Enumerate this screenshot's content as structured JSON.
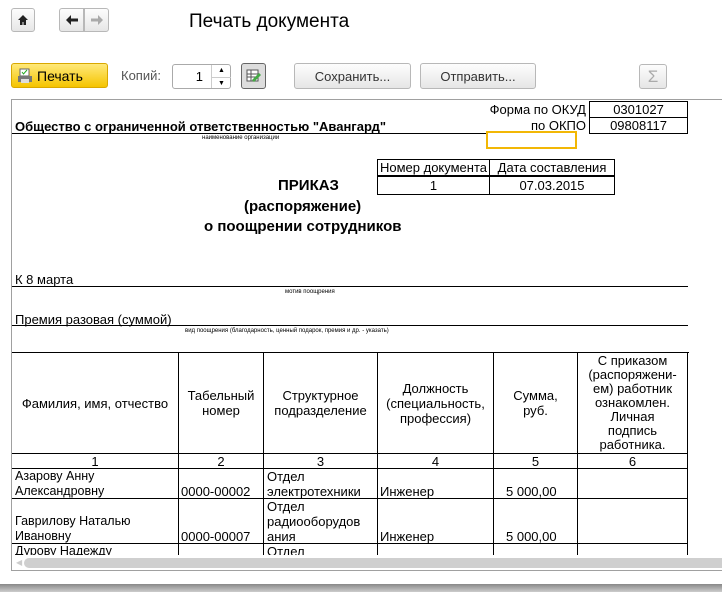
{
  "window": {
    "title": "Печать документа"
  },
  "toolbar": {
    "print_label": "Печать",
    "copies_label": "Копий:",
    "copies_value": "1",
    "save_label": "Сохранить...",
    "send_label": "Отправить...",
    "sum_symbol": "Σ"
  },
  "doc": {
    "org_name": "Общество с ограниченной ответственностью \"Авангард\"",
    "org_caption": "наименование организации",
    "okud_label": "Форма по ОКУД",
    "okud_value": "0301027",
    "okpo_label": "по ОКПО",
    "okpo_value": "09808117",
    "docnum_header": "Номер документа",
    "date_header": "Дата составления",
    "docnum_value": "1",
    "date_value": "07.03.2015",
    "title1": "ПРИКАЗ",
    "title2": "(распоряжение)",
    "title3": "о поощрении сотрудников",
    "motive": "К 8 марта",
    "motive_caption": "мотив поощрения",
    "kind": "Премия разовая (суммой)",
    "kind_caption": "вид поощрения (благодарность, ценный подарок, премия и др. - указать)",
    "columns": [
      "Фамилия, имя, отчество",
      "Табельный номер",
      "Структурное подразделение",
      "Должность (специальность, профессия)",
      "Сумма, руб.",
      "С приказом (распоряжени-ем) работник ознакомлен. Личная подпись работника."
    ],
    "col_numbers": [
      "1",
      "2",
      "3",
      "4",
      "5",
      "6"
    ],
    "rows": [
      {
        "name": "Азарову Анну Александровну",
        "tab": "0000-00002",
        "dept": "Отдел электротехники",
        "pos": "Инженер",
        "sum": "5 000,00",
        "sign": ""
      },
      {
        "name": "Гаврилову Наталью Ивановну",
        "tab": "0000-00007",
        "dept": "Отдел радиооборудов ания",
        "pos": "Инженер",
        "sum": "5 000,00",
        "sign": ""
      },
      {
        "name": "Дурову Надежду",
        "tab": "",
        "dept": "Отдел",
        "pos": "",
        "sum": "",
        "sign": ""
      }
    ]
  }
}
